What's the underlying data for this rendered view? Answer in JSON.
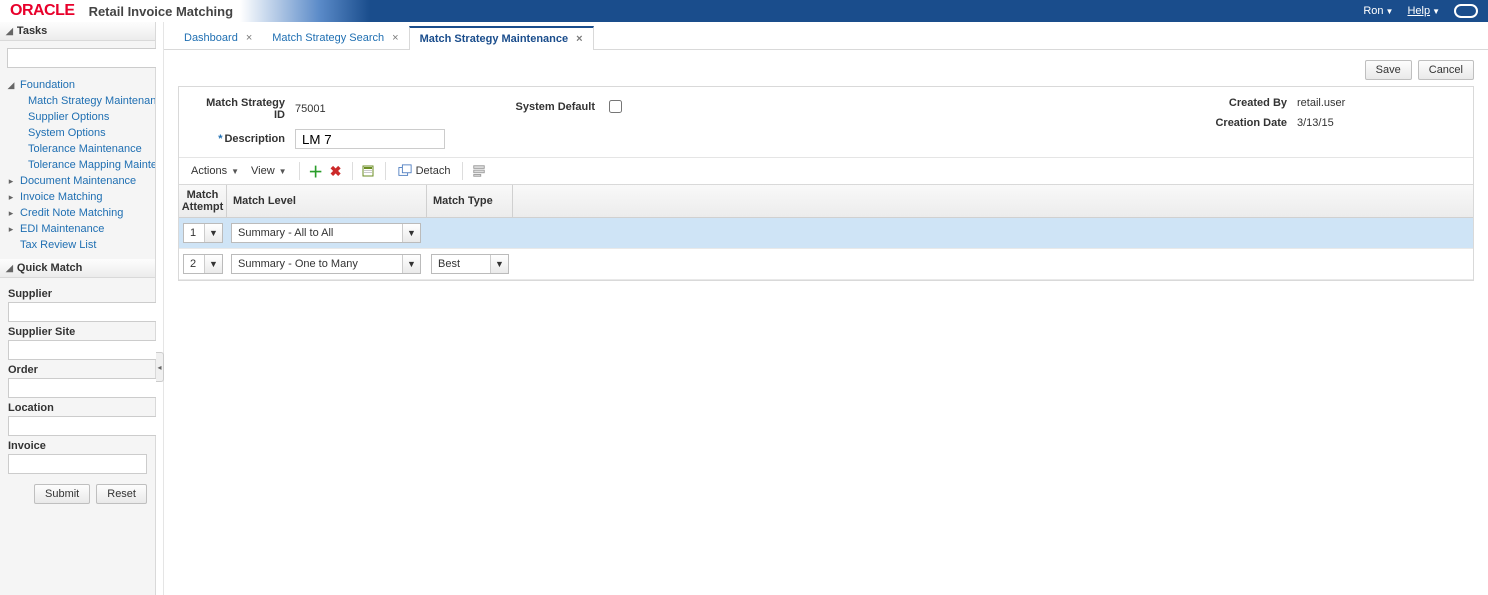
{
  "header": {
    "brand": "ORACLE",
    "app_title": "Retail Invoice Matching",
    "user_menu": "Ron",
    "help_menu": "Help"
  },
  "sidebar": {
    "tasks_title": "Tasks",
    "search_placeholder": "",
    "nav": {
      "foundation": {
        "label": "Foundation",
        "items": [
          "Match Strategy Maintenance",
          "Supplier Options",
          "System Options",
          "Tolerance Maintenance",
          "Tolerance Mapping Maintena"
        ]
      },
      "others": [
        "Document Maintenance",
        "Invoice Matching",
        "Credit Note Matching",
        "EDI Maintenance",
        "Tax Review List"
      ]
    },
    "quick_match": {
      "title": "Quick Match",
      "fields": {
        "supplier": "Supplier",
        "supplier_site": "Supplier Site",
        "order": "Order",
        "location": "Location",
        "invoice": "Invoice"
      },
      "submit": "Submit",
      "reset": "Reset"
    }
  },
  "tabs": [
    {
      "label": "Dashboard",
      "active": false
    },
    {
      "label": "Match Strategy Search",
      "active": false
    },
    {
      "label": "Match Strategy Maintenance",
      "active": true
    }
  ],
  "page_actions": {
    "save": "Save",
    "cancel": "Cancel"
  },
  "form": {
    "labels": {
      "id": "Match Strategy ID",
      "description": "Description",
      "system_default": "System Default",
      "created_by": "Created By",
      "creation_date": "Creation Date"
    },
    "values": {
      "id": "75001",
      "description": "LM 7",
      "system_default_checked": false,
      "created_by": "retail.user",
      "creation_date": "3/13/15"
    }
  },
  "toolbar": {
    "actions": "Actions",
    "view": "View",
    "detach": "Detach"
  },
  "grid": {
    "columns": {
      "attempt1": "Match",
      "attempt2": "Attempt",
      "level": "Match Level",
      "type": "Match Type"
    },
    "rows": [
      {
        "attempt": "1",
        "level": "Summary - All to All",
        "type": "",
        "selected": true
      },
      {
        "attempt": "2",
        "level": "Summary - One to Many",
        "type": "Best",
        "selected": false
      }
    ]
  }
}
